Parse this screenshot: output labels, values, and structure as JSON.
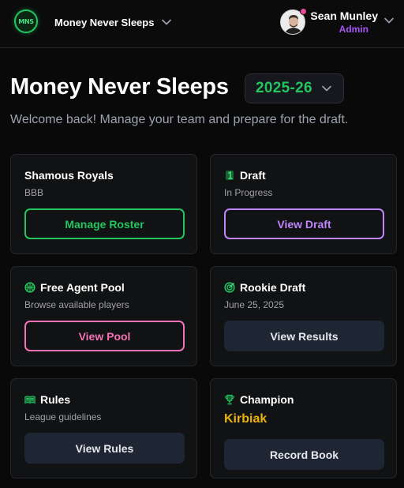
{
  "header": {
    "logo_text": "MNS",
    "league_name": "Money Never Sleeps",
    "user_name": "Sean Munley",
    "user_role": "Admin"
  },
  "main": {
    "title": "Money Never Sleeps",
    "season": "2025-26",
    "welcome": "Welcome back! Manage your team and prepare for the draft."
  },
  "cards": {
    "team": {
      "title": "Shamous Royals",
      "subtitle": "BBB",
      "button": "Manage Roster"
    },
    "draft": {
      "title": "Draft",
      "subtitle": "In Progress",
      "button": "View Draft",
      "icon": "number-one-icon"
    },
    "free_agent": {
      "title": "Free Agent Pool",
      "subtitle": "Browse available players",
      "button": "View Pool",
      "icon": "basketball-icon"
    },
    "rookie": {
      "title": "Rookie Draft",
      "subtitle": "June 25, 2025",
      "button": "View Results",
      "icon": "target-icon"
    },
    "rules": {
      "title": "Rules",
      "subtitle": "League guidelines",
      "button": "View Rules",
      "icon": "book-icon"
    },
    "champion": {
      "title": "Champion",
      "value": "Kirbiak",
      "button": "Record Book",
      "icon": "trophy-icon"
    }
  },
  "colors": {
    "accent_green": "#22c55e",
    "accent_purple": "#c084fc",
    "accent_pink": "#f472b6",
    "champion_gold": "#eab308",
    "background": "#090909"
  }
}
